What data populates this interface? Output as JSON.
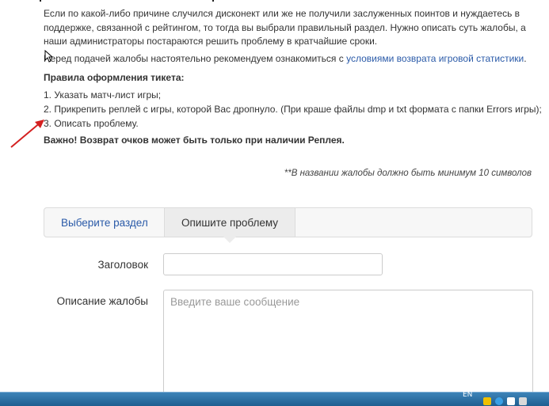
{
  "intro": {
    "paragraph1": "Если по какой-либо причине случился дисконект или же не получили заслуженных поинтов и нуждаетесь в поддержке, связанной с рейтингом, то тогда вы выбрали правильный раздел. Нужно описать суть жалобы, а наши администраторы постараются решить проблему в кратчайшие сроки.",
    "paragraph2_prefix": "Перед подачей жалобы настоятельно рекомендуем ознакомиться с",
    "paragraph2_link": "условиями возврата игровой статистики",
    "paragraph2_suffix": "."
  },
  "rules": {
    "title": "Правила оформления тикета:",
    "items": [
      "1. Указать матч-лист игры;",
      "2. Прикрепить реплей с игры, которой Вас дропнуло. (При краше файлы dmp и txt формата с папки Errors игры);",
      "3. Описать проблему."
    ],
    "important": "Важно! Возврат очков может быть только при наличии Реплея."
  },
  "note": "**В названии жалобы должно быть минимум 10 символов",
  "tabs": [
    {
      "label": "Выберите раздел",
      "active": false
    },
    {
      "label": "Опишите проблему",
      "active": true
    }
  ],
  "form": {
    "title_label": "Заголовок",
    "title_value": "",
    "description_label": "Описание жалобы",
    "description_placeholder": "Введите ваше сообщение"
  },
  "taskbar": {
    "language": "EN"
  },
  "colors": {
    "link": "#2a5aa8",
    "annotation_arrow": "#d42020",
    "taskbar": "#2a6fa5"
  }
}
